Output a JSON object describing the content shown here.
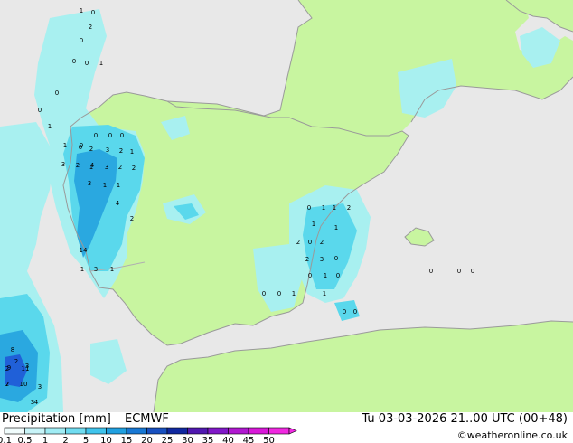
{
  "map": {
    "colors": {
      "sea": "#e8e8e8",
      "land": "#c8f5a0",
      "precip_light": "#a8f0f0",
      "precip_medium": "#5ad8ec",
      "precip_strong": "#2aa8e0",
      "precip_heavy": "#2060d8",
      "coast": "#9a9a9a"
    },
    "values": [
      {
        "v": "1"
      },
      {
        "v": "0"
      },
      {
        "v": "2"
      },
      {
        "v": "0"
      },
      {
        "v": "0"
      },
      {
        "v": "0"
      },
      {
        "v": "1"
      },
      {
        "v": "0"
      },
      {
        "v": "0"
      },
      {
        "v": "1"
      },
      {
        "v": "1"
      },
      {
        "v": "0"
      },
      {
        "v": "0"
      },
      {
        "v": "0"
      },
      {
        "v": "0"
      },
      {
        "v": "0"
      },
      {
        "v": "2"
      },
      {
        "v": "3"
      },
      {
        "v": "2"
      },
      {
        "v": "1"
      },
      {
        "v": "3"
      },
      {
        "v": "2"
      },
      {
        "v": "1"
      },
      {
        "v": "4"
      },
      {
        "v": "3"
      },
      {
        "v": "2"
      },
      {
        "v": "2"
      },
      {
        "v": "3"
      },
      {
        "v": "1"
      },
      {
        "v": "1"
      },
      {
        "v": "4"
      },
      {
        "v": "2"
      },
      {
        "v": "14"
      },
      {
        "v": "1"
      },
      {
        "v": "3"
      },
      {
        "v": "1"
      },
      {
        "v": "2"
      },
      {
        "v": "3"
      },
      {
        "v": "2"
      },
      {
        "v": "2"
      },
      {
        "v": "8"
      },
      {
        "v": "11"
      },
      {
        "v": "9"
      },
      {
        "v": "7"
      },
      {
        "v": "10"
      },
      {
        "v": "3"
      },
      {
        "v": "3"
      },
      {
        "v": "4"
      },
      {
        "v": "1"
      },
      {
        "v": "2"
      },
      {
        "v": "1"
      },
      {
        "v": "0"
      },
      {
        "v": "1"
      },
      {
        "v": "2"
      },
      {
        "v": "0"
      },
      {
        "v": "2"
      },
      {
        "v": "1"
      },
      {
        "v": "2"
      },
      {
        "v": "3"
      },
      {
        "v": "0"
      },
      {
        "v": "1"
      },
      {
        "v": "0"
      },
      {
        "v": "0"
      },
      {
        "v": "1"
      },
      {
        "v": "0"
      },
      {
        "v": "1"
      },
      {
        "v": "0"
      },
      {
        "v": "0"
      },
      {
        "v": "0"
      },
      {
        "v": "0"
      },
      {
        "v": "0"
      },
      {
        "v": "0"
      }
    ]
  },
  "footer": {
    "title": "Precipitation [mm]",
    "model": "ECMWF",
    "datetime": "Tu 03-03-2026 21..00 UTC (00+48)",
    "credit": "©weatheronline.co.uk",
    "legend": [
      {
        "label": "0.1",
        "color": "#f0fcfc"
      },
      {
        "label": "0.5",
        "color": "#c8f4f8"
      },
      {
        "label": "1",
        "color": "#a0ecf4"
      },
      {
        "label": "2",
        "color": "#70dcf0"
      },
      {
        "label": "5",
        "color": "#40c4ec"
      },
      {
        "label": "10",
        "color": "#20a0e0"
      },
      {
        "label": "15",
        "color": "#1878d4"
      },
      {
        "label": "20",
        "color": "#1850c0"
      },
      {
        "label": "25",
        "color": "#1028a0"
      },
      {
        "label": "30",
        "color": "#5018b0"
      },
      {
        "label": "35",
        "color": "#8018c8"
      },
      {
        "label": "40",
        "color": "#b018d0"
      },
      {
        "label": "45",
        "color": "#d818d8"
      },
      {
        "label": "50",
        "color": "#f028e0"
      }
    ]
  }
}
